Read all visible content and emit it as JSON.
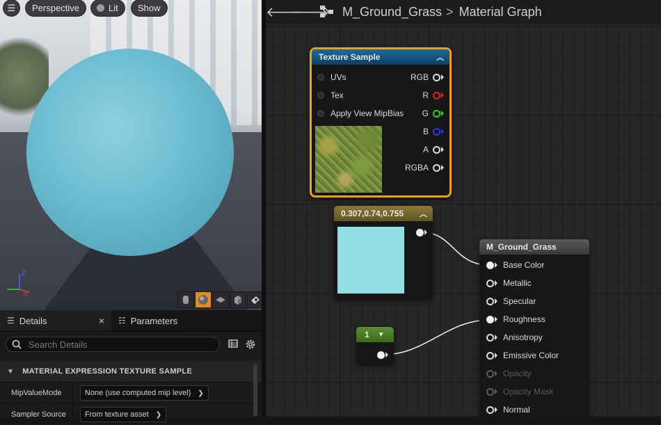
{
  "viewport": {
    "menu_icon": "hamburger-icon",
    "perspective_label": "Perspective",
    "lit_label": "Lit",
    "show_label": "Show",
    "axis_labels": {
      "z": "Z",
      "x": "X"
    },
    "preview_shapes": [
      "cylinder-icon",
      "sphere-icon",
      "plane-icon",
      "cube-icon",
      "custom-mesh-icon"
    ]
  },
  "details": {
    "tabs": [
      {
        "label": "Details",
        "icon": "details-icon"
      },
      {
        "label": "Parameters",
        "icon": "parameters-icon"
      }
    ],
    "close_glyph": "×",
    "search_placeholder": "Search Details",
    "section_title": "MATERIAL EXPRESSION TEXTURE SAMPLE",
    "properties": [
      {
        "name": "MipValueMode",
        "value": "None (use computed mip level)"
      },
      {
        "name": "Sampler Source",
        "value": "From texture asset"
      }
    ]
  },
  "graph": {
    "breadcrumb": {
      "asset": "M_Ground_Grass",
      "separator": ">",
      "graph": "Material Graph"
    },
    "texture_node": {
      "title": "Texture Sample",
      "inputs": [
        "UVs",
        "Tex",
        "Apply View MipBias"
      ],
      "outputs": [
        {
          "label": "RGB",
          "color": "#dcdcdc"
        },
        {
          "label": "R",
          "color": "#e02424"
        },
        {
          "label": "G",
          "color": "#2bd42b"
        },
        {
          "label": "B",
          "color": "#2a3bdc"
        },
        {
          "label": "A",
          "color": "#dcdcdc"
        },
        {
          "label": "RGBA",
          "color": "#dcdcdc"
        }
      ]
    },
    "color_node": {
      "title": "0.307,0.74,0.755",
      "swatch": "#93e0e4"
    },
    "scalar_node": {
      "value": "1"
    },
    "material_node": {
      "title": "M_Ground_Grass",
      "pins": [
        {
          "label": "Base Color",
          "connected": true,
          "enabled": true
        },
        {
          "label": "Metallic",
          "connected": false,
          "enabled": true
        },
        {
          "label": "Specular",
          "connected": false,
          "enabled": true
        },
        {
          "label": "Roughness",
          "connected": true,
          "enabled": true
        },
        {
          "label": "Anisotropy",
          "connected": false,
          "enabled": true
        },
        {
          "label": "Emissive Color",
          "connected": false,
          "enabled": true
        },
        {
          "label": "Opacity",
          "connected": false,
          "enabled": false
        },
        {
          "label": "Opacity Mask",
          "connected": false,
          "enabled": false
        },
        {
          "label": "Normal",
          "connected": false,
          "enabled": true
        }
      ]
    },
    "colors": {
      "selection": "#f0a020",
      "texture_header": "#14527a",
      "color_header": "#7c6a2a",
      "scalar_header": "#4d7a2a"
    }
  }
}
